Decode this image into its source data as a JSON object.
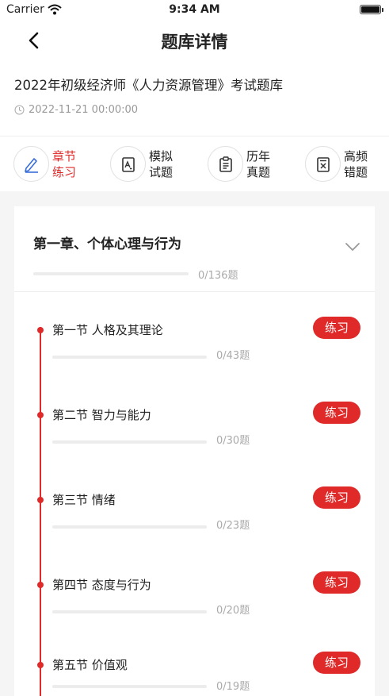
{
  "status_bar": {
    "carrier": "Carrier",
    "time": "9:34 AM"
  },
  "nav": {
    "title": "题库详情"
  },
  "exam": {
    "title": "2022年初级经济师《人力资源管理》考试题库",
    "date": "2022-11-21 00:00:00"
  },
  "tabs": [
    {
      "label": "章节练习",
      "icon": "pencil-icon"
    },
    {
      "label": "模拟试题",
      "icon": "exam-paper-icon"
    },
    {
      "label": "历年真题",
      "icon": "clipboard-icon"
    },
    {
      "label": "高频错题",
      "icon": "wrong-question-icon"
    }
  ],
  "chapter": {
    "title": "第一章、个体心理与行为",
    "count": "0/136题",
    "progress": 0
  },
  "sections": [
    {
      "name": "第一节 人格及其理论",
      "count": "0/43题",
      "button": "练习",
      "progress": 0
    },
    {
      "name": "第二节 智力与能力",
      "count": "0/30题",
      "button": "练习",
      "progress": 0
    },
    {
      "name": "第三节 情绪",
      "count": "0/23题",
      "button": "练习",
      "progress": 0
    },
    {
      "name": "第四节 态度与行为",
      "count": "0/20题",
      "button": "练习",
      "progress": 0
    },
    {
      "name": "第五节 价值观",
      "count": "0/19题",
      "button": "练习",
      "progress": 0
    }
  ],
  "colors": {
    "accent": "#e02a2a",
    "track": "#ececec",
    "muted": "#999999"
  }
}
